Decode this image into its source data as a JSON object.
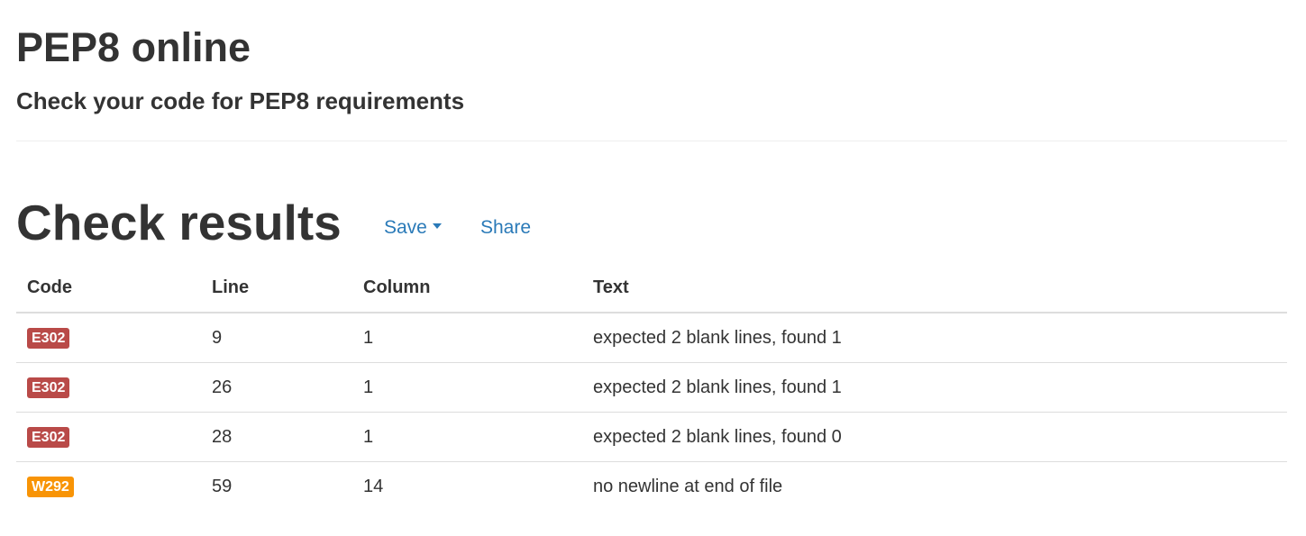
{
  "header": {
    "title": "PEP8 online",
    "subtitle": "Check your code for PEP8 requirements"
  },
  "results": {
    "title": "Check results",
    "save_label": "Save",
    "share_label": "Share",
    "columns": [
      "Code",
      "Line",
      "Column",
      "Text"
    ],
    "rows": [
      {
        "code": "E302",
        "severity": "error",
        "line": "9",
        "column": "1",
        "text": "expected 2 blank lines, found 1"
      },
      {
        "code": "E302",
        "severity": "error",
        "line": "26",
        "column": "1",
        "text": "expected 2 blank lines, found 1"
      },
      {
        "code": "E302",
        "severity": "error",
        "line": "28",
        "column": "1",
        "text": "expected 2 blank lines, found 0"
      },
      {
        "code": "W292",
        "severity": "warning",
        "line": "59",
        "column": "14",
        "text": "no newline at end of file"
      }
    ]
  },
  "colors": {
    "error_badge": "#b94a48",
    "warning_badge": "#f89406",
    "link": "#2a7ab8",
    "text": "#333333"
  },
  "icons": {
    "save_dropdown": "caret-down-icon"
  }
}
